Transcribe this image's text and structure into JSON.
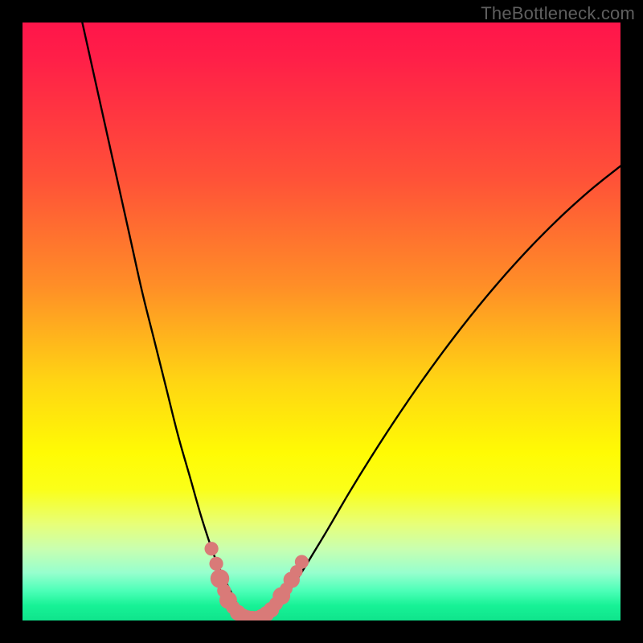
{
  "watermark": "TheBottleneck.com",
  "colors": {
    "marker_fill": "#d97a78",
    "marker_stroke": "#d97a78",
    "curve_stroke": "#000000"
  },
  "chart_data": {
    "type": "line",
    "title": "",
    "xlabel": "",
    "ylabel": "",
    "xlim": [
      0,
      100
    ],
    "ylim": [
      0,
      100
    ],
    "curve": {
      "x": [
        10,
        12,
        14,
        16,
        18,
        20,
        22,
        24,
        26,
        28,
        30,
        32,
        33.5,
        35,
        36,
        37,
        38,
        39,
        40,
        42,
        45,
        50,
        55,
        60,
        65,
        70,
        75,
        80,
        85,
        90,
        95,
        100
      ],
      "y": [
        100,
        91,
        82,
        73,
        64,
        55,
        47,
        39,
        31,
        24,
        17,
        11,
        7.5,
        4.5,
        2.6,
        1.4,
        0.5,
        0.2,
        0.5,
        2.0,
        5.5,
        13.5,
        22,
        30,
        37.5,
        44.5,
        51,
        57,
        62.5,
        67.5,
        72,
        76
      ]
    },
    "markers": [
      {
        "x": 31.6,
        "y": 12.0,
        "r": 1.1
      },
      {
        "x": 32.4,
        "y": 9.5,
        "r": 1.1
      },
      {
        "x": 33.0,
        "y": 7.0,
        "r": 1.5
      },
      {
        "x": 33.7,
        "y": 5.0,
        "r": 1.1
      },
      {
        "x": 34.4,
        "y": 3.4,
        "r": 1.4
      },
      {
        "x": 35.2,
        "y": 2.2,
        "r": 1.1
      },
      {
        "x": 36.0,
        "y": 1.3,
        "r": 1.25
      },
      {
        "x": 36.8,
        "y": 0.7,
        "r": 1.25
      },
      {
        "x": 37.6,
        "y": 0.4,
        "r": 1.25
      },
      {
        "x": 38.4,
        "y": 0.3,
        "r": 1.25
      },
      {
        "x": 39.2,
        "y": 0.3,
        "r": 1.25
      },
      {
        "x": 40.0,
        "y": 0.6,
        "r": 1.25
      },
      {
        "x": 40.8,
        "y": 1.1,
        "r": 1.25
      },
      {
        "x": 41.6,
        "y": 1.8,
        "r": 1.25
      },
      {
        "x": 42.4,
        "y": 2.8,
        "r": 1.1
      },
      {
        "x": 43.3,
        "y": 4.1,
        "r": 1.4
      },
      {
        "x": 44.1,
        "y": 5.3,
        "r": 1.0
      },
      {
        "x": 45.0,
        "y": 6.8,
        "r": 1.3
      },
      {
        "x": 45.8,
        "y": 8.2,
        "r": 1.0
      },
      {
        "x": 46.7,
        "y": 9.8,
        "r": 1.1
      }
    ]
  }
}
